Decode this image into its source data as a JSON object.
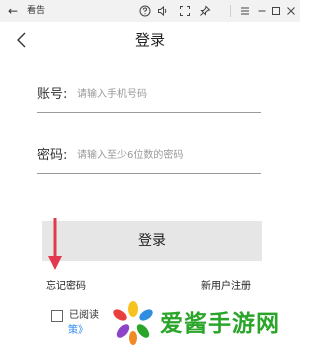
{
  "window": {
    "title": "看告",
    "back_glyph": "←",
    "icons": [
      "help-icon",
      "volume-icon",
      "fullscreen-icon",
      "pin-icon",
      "menu-icon",
      "minimize-icon",
      "maximize-icon",
      "close-icon"
    ]
  },
  "page": {
    "title": "登录"
  },
  "account": {
    "label": "账号:",
    "placeholder": "请输入手机号码",
    "value": ""
  },
  "password": {
    "label": "密码:",
    "placeholder": "请输入至少6位数的密码",
    "value": ""
  },
  "login_button_label": "登录",
  "links": {
    "forgot": "忘记密码",
    "register": "新用户注册"
  },
  "agreement": {
    "text": "已阅读",
    "policy": "策》",
    "checked": false
  },
  "watermark": {
    "text": "爱酱手游网"
  },
  "colors": {
    "accent_arrow": "#e2394f",
    "link_blue": "#2d8cf0",
    "watermark_green": "#2aa52a",
    "button_bg": "#e6e6e6"
  }
}
